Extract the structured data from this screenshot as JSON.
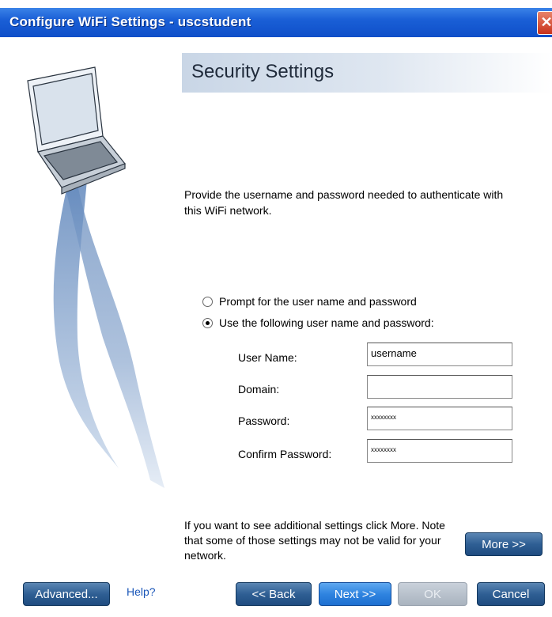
{
  "window": {
    "title": "Configure WiFi Settings - uscstudent",
    "close_glyph": "✕"
  },
  "header": {
    "title": "Security Settings"
  },
  "description": "Provide the username and password needed to authenticate with this WiFi network.",
  "options": [
    {
      "label": "Prompt for the user name and password",
      "selected": false
    },
    {
      "label": "Use the following user name and password:",
      "selected": true
    }
  ],
  "fields": {
    "username": {
      "label": "User Name:",
      "value": "username"
    },
    "domain": {
      "label": "Domain:",
      "value": ""
    },
    "password": {
      "label": "Password:",
      "value": "xxxxxxxx"
    },
    "confirm": {
      "label": "Confirm Password:",
      "value": "xxxxxxxx"
    }
  },
  "note": "If you want to see additional settings click More. Note that some of those settings may not be valid for your network.",
  "buttons": {
    "more": "More >>",
    "advanced": "Advanced...",
    "help": "Help?",
    "back": "<< Back",
    "next": "Next >>",
    "ok": "OK",
    "cancel": "Cancel"
  }
}
